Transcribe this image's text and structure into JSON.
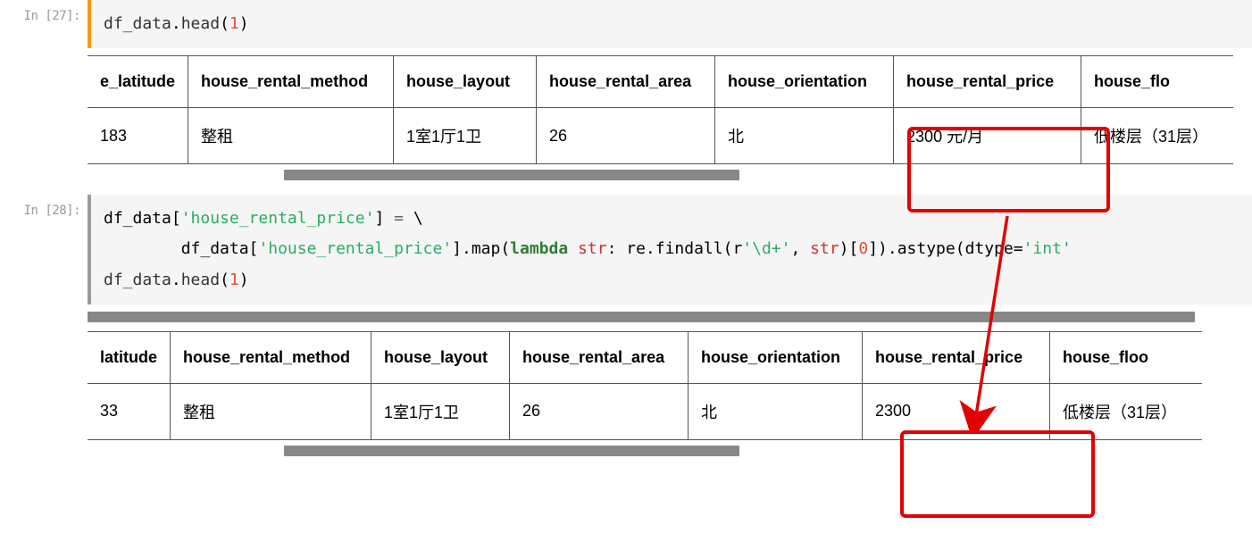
{
  "cell27": {
    "prompt": "In [27]:",
    "code": {
      "id1": "df_data",
      "dot": ".",
      "method": "head",
      "lp": "(",
      "arg": "1",
      "rp": ")"
    },
    "table": {
      "headers": [
        "e_latitude",
        "house_rental_method",
        "house_layout",
        "house_rental_area",
        "house_orientation",
        "house_rental_price",
        "house_flo"
      ],
      "row": [
        "183",
        "整租",
        "1室1厅1卫",
        "26",
        "北",
        "2300 元/月",
        "低楼层（31层）"
      ]
    }
  },
  "cell28": {
    "prompt": "In [28]:",
    "code_line1": {
      "p1": "df_data[",
      "s1": "'house_rental_price'",
      "p2": "] ",
      "op": "=",
      "bs": " \\"
    },
    "code_line2": {
      "indent": "        df_data[",
      "s1": "'house_rental_price'",
      "p1": "].map(",
      "kw": "lambda",
      "sp": " ",
      "bi": "str",
      "p2": ": re.findall(r",
      "s2": "'\\d+'",
      "p3": ", ",
      "bi2": "str",
      "p4": ")[",
      "n0": "0",
      "p5": "]).astype(dtype=",
      "s3": "'int'",
      "p6": ""
    },
    "code_line3": {
      "id1": "df_data",
      "dot": ".",
      "method": "head",
      "lp": "(",
      "arg": "1",
      "rp": ")"
    },
    "table": {
      "headers": [
        "latitude",
        "house_rental_method",
        "house_layout",
        "house_rental_area",
        "house_orientation",
        "house_rental_price",
        "house_floo"
      ],
      "row": [
        "33",
        "整租",
        "1室1厅1卫",
        "26",
        "北",
        "2300",
        "低楼层（31层）"
      ]
    }
  }
}
